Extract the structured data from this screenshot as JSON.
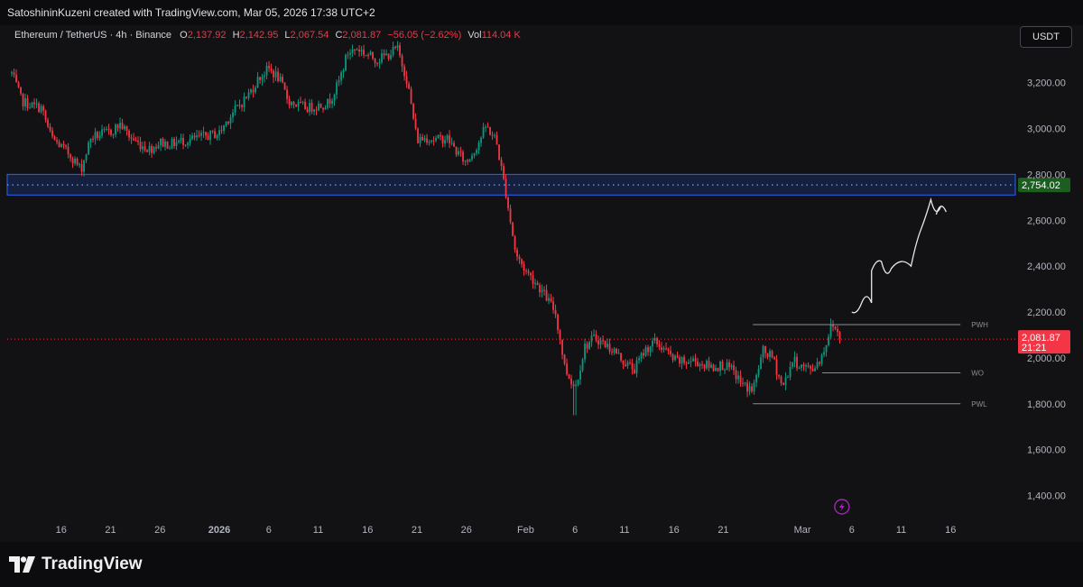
{
  "header": {
    "attribution": "SatoshininKuzeni created with TradingView.com, Mar 05, 2026 17:38 UTC+2"
  },
  "legend": {
    "symbol": "Ethereum / TetherUS · 4h · Binance",
    "o_label": "O",
    "o_value": "2,137.92",
    "h_label": "H",
    "h_value": "2,142.95",
    "l_label": "L",
    "l_value": "2,067.54",
    "c_label": "C",
    "c_value": "2,081.87",
    "change": "−56.05 (−2.62%)",
    "vol_label": "Vol",
    "vol_value": "114.04 K"
  },
  "currency_button": "USDT",
  "footer": {
    "logo_text": "TradingView",
    "logo_icon": "tradingview-logo-icon"
  },
  "flash_icon": "lightning-icon",
  "colors": {
    "up": "#089981",
    "down": "#f23645",
    "zone": "#2962ff",
    "zone_label_bg": "#1b5e20",
    "price_label_bg": "#f23645",
    "background": "#121214"
  },
  "chart_data": {
    "type": "candlestick",
    "title": "Ethereum / TetherUS · 4h · Binance",
    "ylim": [
      1300,
      3450
    ],
    "grid": false,
    "y_ticks": [
      3200,
      3000,
      2800,
      2600,
      2400,
      2200,
      2000,
      1800,
      1600,
      1400
    ],
    "y_tick_labels": [
      "3,200.00",
      "3,000.00",
      "2,800.00",
      "2,600.00",
      "2,400.00",
      "2,200.00",
      "2,000.00",
      "1,800.00",
      "1,600.00",
      "1,400.00"
    ],
    "x_ticks": [
      {
        "label": "16",
        "date": "2025-12-16"
      },
      {
        "label": "21",
        "date": "2025-12-21"
      },
      {
        "label": "26",
        "date": "2025-12-26"
      },
      {
        "label": "2026",
        "date": "2026-01-01",
        "bold": true
      },
      {
        "label": "6",
        "date": "2026-01-06"
      },
      {
        "label": "11",
        "date": "2026-01-11"
      },
      {
        "label": "16",
        "date": "2026-01-16"
      },
      {
        "label": "21",
        "date": "2026-01-21"
      },
      {
        "label": "26",
        "date": "2026-01-26"
      },
      {
        "label": "Feb",
        "date": "2026-02-01"
      },
      {
        "label": "6",
        "date": "2026-02-06"
      },
      {
        "label": "11",
        "date": "2026-02-11"
      },
      {
        "label": "16",
        "date": "2026-02-16"
      },
      {
        "label": "21",
        "date": "2026-02-21"
      },
      {
        "label": "Mar",
        "date": "2026-03-01"
      },
      {
        "label": "6",
        "date": "2026-03-06"
      },
      {
        "label": "11",
        "date": "2026-03-11"
      },
      {
        "label": "16",
        "date": "2026-03-16"
      }
    ],
    "price_path": [
      [
        "2025-12-11",
        3240
      ],
      [
        "2025-12-12",
        3120
      ],
      [
        "2025-12-13",
        3100
      ],
      [
        "2025-12-14",
        3090
      ],
      [
        "2025-12-15",
        2960
      ],
      [
        "2025-12-16",
        2920
      ],
      [
        "2025-12-17",
        2880
      ],
      [
        "2025-12-18",
        2820
      ],
      [
        "2025-12-19",
        2960
      ],
      [
        "2025-12-20",
        2975
      ],
      [
        "2025-12-21",
        2985
      ],
      [
        "2025-12-22",
        3020
      ],
      [
        "2025-12-23",
        2960
      ],
      [
        "2025-12-24",
        2930
      ],
      [
        "2025-12-25",
        2910
      ],
      [
        "2025-12-26",
        2940
      ],
      [
        "2025-12-27",
        2930
      ],
      [
        "2025-12-28",
        2945
      ],
      [
        "2025-12-29",
        2950
      ],
      [
        "2025-12-30",
        2960
      ],
      [
        "2025-12-31",
        2970
      ],
      [
        "2026-01-01",
        2980
      ],
      [
        "2026-01-02",
        3050
      ],
      [
        "2026-01-03",
        3100
      ],
      [
        "2026-01-04",
        3150
      ],
      [
        "2026-01-05",
        3220
      ],
      [
        "2026-01-06",
        3260
      ],
      [
        "2026-01-07",
        3220
      ],
      [
        "2026-01-08",
        3120
      ],
      [
        "2026-01-09",
        3100
      ],
      [
        "2026-01-10",
        3090
      ],
      [
        "2026-01-11",
        3100
      ],
      [
        "2026-01-12",
        3110
      ],
      [
        "2026-01-13",
        3190
      ],
      [
        "2026-01-14",
        3330
      ],
      [
        "2026-01-15",
        3350
      ],
      [
        "2026-01-16",
        3320
      ],
      [
        "2026-01-17",
        3300
      ],
      [
        "2026-01-18",
        3320
      ],
      [
        "2026-01-19",
        3350
      ],
      [
        "2026-01-20",
        3210
      ],
      [
        "2026-01-21",
        2950
      ],
      [
        "2026-01-22",
        2960
      ],
      [
        "2026-01-23",
        2950
      ],
      [
        "2026-01-24",
        2960
      ],
      [
        "2026-01-25",
        2900
      ],
      [
        "2026-01-26",
        2850
      ],
      [
        "2026-01-27",
        2920
      ],
      [
        "2026-01-28",
        3010
      ],
      [
        "2026-01-29",
        2950
      ],
      [
        "2026-01-30",
        2720
      ],
      [
        "2026-01-31",
        2450
      ],
      [
        "2026-02-01",
        2380
      ],
      [
        "2026-02-02",
        2330
      ],
      [
        "2026-02-03",
        2270
      ],
      [
        "2026-02-04",
        2200
      ],
      [
        "2026-02-05",
        1950
      ],
      [
        "2026-02-06",
        1870
      ],
      [
        "2026-02-07",
        2050
      ],
      [
        "2026-02-08",
        2090
      ],
      [
        "2026-02-09",
        2060
      ],
      [
        "2026-02-10",
        2030
      ],
      [
        "2026-02-11",
        1980
      ],
      [
        "2026-02-12",
        1950
      ],
      [
        "2026-02-13",
        2030
      ],
      [
        "2026-02-14",
        2070
      ],
      [
        "2026-02-15",
        2040
      ],
      [
        "2026-02-16",
        1990
      ],
      [
        "2026-02-17",
        1980
      ],
      [
        "2026-02-18",
        1990
      ],
      [
        "2026-02-19",
        1970
      ],
      [
        "2026-02-20",
        1960
      ],
      [
        "2026-02-21",
        1970
      ],
      [
        "2026-02-22",
        1940
      ],
      [
        "2026-02-23",
        1880
      ],
      [
        "2026-02-24",
        1860
      ],
      [
        "2026-02-25",
        2030
      ],
      [
        "2026-02-26",
        2000
      ],
      [
        "2026-02-27",
        1870
      ],
      [
        "2026-02-28",
        1990
      ],
      [
        "2026-03-01",
        1960
      ],
      [
        "2026-03-02",
        1950
      ],
      [
        "2026-03-03",
        2010
      ],
      [
        "2026-03-04",
        2150
      ],
      [
        "2026-03-05",
        2081.87
      ]
    ],
    "price_low_extreme": {
      "date": "2026-02-06",
      "value": 1750
    },
    "zone": {
      "from": 2710,
      "to": 2800,
      "label": "2,754.02",
      "value": 2754.02
    },
    "current_price": {
      "value": 2081.87,
      "label": "2,081.87",
      "countdown": "21:21"
    },
    "levels": [
      {
        "name": "PWH",
        "value": 2145,
        "from": "2026-02-24",
        "to": "2026-03-17"
      },
      {
        "name": "WO",
        "value": 1935,
        "from": "2026-03-03",
        "to": "2026-03-17"
      },
      {
        "name": "PWL",
        "value": 1800,
        "from": "2026-02-24",
        "to": "2026-03-17"
      }
    ],
    "projection": [
      [
        "2026-03-06",
        2200
      ],
      [
        "2026-03-07",
        2240
      ],
      [
        "2026-03-08",
        2240
      ],
      [
        "2026-03-08",
        2380
      ],
      [
        "2026-03-09",
        2420
      ],
      [
        "2026-03-10",
        2390
      ],
      [
        "2026-03-12",
        2400
      ],
      [
        "2026-03-13",
        2560
      ],
      [
        "2026-03-14",
        2690
      ],
      [
        "2026-03-15",
        2660
      ]
    ]
  }
}
